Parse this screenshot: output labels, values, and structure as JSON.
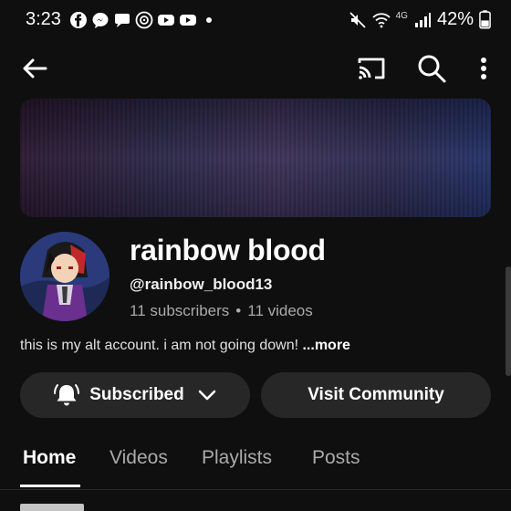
{
  "status": {
    "time": "3:23",
    "battery": "42%",
    "network": "4G",
    "left_icons": [
      "facebook-icon",
      "messenger-icon",
      "chat-icon",
      "threads-icon",
      "youtube-icon",
      "youtube-icon"
    ],
    "right_icons": [
      "mute-icon",
      "wifi-icon",
      "signal-icon",
      "battery-icon"
    ]
  },
  "app_bar": {
    "icons": [
      "back-arrow-icon",
      "cast-icon",
      "search-icon",
      "more-vert-icon"
    ]
  },
  "channel": {
    "name": "rainbow blood",
    "handle": "@rainbow_blood13",
    "subscribers": "11 subscribers",
    "separator": "•",
    "videos": "11 videos",
    "description": "this is my alt account. i am not going down! ",
    "more": "...more"
  },
  "actions": {
    "subscribed_label": "Subscribed",
    "community_label": "Visit Community"
  },
  "tabs": [
    {
      "label": "Home",
      "active": true
    },
    {
      "label": "Videos",
      "active": false
    },
    {
      "label": "Playlists",
      "active": false
    },
    {
      "label": "Posts",
      "active": false
    }
  ],
  "colors": {
    "background": "#0f0f0f",
    "pill": "#272727",
    "secondary_text": "#aaaaaa"
  }
}
